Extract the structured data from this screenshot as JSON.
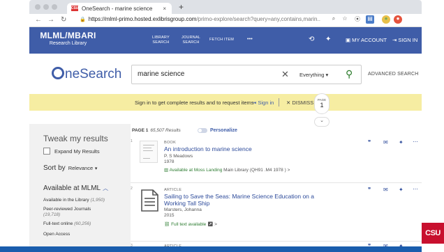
{
  "browser": {
    "tab_title": "OneSearch - marine science",
    "favicon_text": "CSU",
    "tab_close": "×",
    "new_tab": "+",
    "url_lock": "🔒",
    "url_host": "https://mlml-primo.hosted.exlibrisgroup.com",
    "url_path": "/primo-explore/search?query=any,contains,marin..."
  },
  "header": {
    "brand_main": "MLML/MBARI",
    "brand_sub": "Research Library",
    "nav": [
      {
        "line1": "LIBRARY",
        "line2": "SEARCH"
      },
      {
        "line1": "JOURNAL",
        "line2": "SEARCH"
      },
      {
        "line1": "FETCH ITEM",
        "line2": ""
      },
      {
        "line1": "•••",
        "line2": ""
      }
    ],
    "my_account": "MY ACCOUNT",
    "sign_in": "SIGN IN"
  },
  "search": {
    "logo_text": "neSearch",
    "query": "marine science",
    "scope": "Everything",
    "advanced": "ADVANCED SEARCH"
  },
  "notice": {
    "text": "Sign in to get complete results and to request items",
    "sign_in": "Sign in",
    "dismiss": "DISMISS"
  },
  "sidebar": {
    "title": "Tweak my results",
    "expand": "Expand My Results",
    "sort_label": "Sort by",
    "sort_value": "Relevance",
    "avail_title": "Available at MLML",
    "facets": [
      {
        "label": "Available in the Library",
        "count": "(1,950)"
      },
      {
        "label": "Peer-reviewed Journals",
        "count": "(19,718)"
      },
      {
        "label": "Full-text online",
        "count": "(60,256)"
      },
      {
        "label": "Open Access",
        "count": ""
      }
    ]
  },
  "results": {
    "page_label": "PAGE 1",
    "count": "65,507 Results",
    "personalize": "Personalize",
    "items": [
      {
        "num": "1",
        "type": "BOOK",
        "title": "An introduction to marine science",
        "author": "P. S Meadows",
        "year": "1978",
        "avail": "Available at Moss Landing",
        "location": "Main Library (QH91 .M4 1978 )",
        "avail_suffix": ">"
      },
      {
        "num": "2",
        "type": "ARTICLE",
        "title": "Sailing to Save the Seas: Marine Science Education on a Working Tall Ship",
        "author": "Marsters, Johanna",
        "year": "2015",
        "avail": "Full text available",
        "location": "",
        "avail_suffix": "↗ >"
      },
      {
        "num": "3",
        "type": "ARTICLE",
        "title": "",
        "author": "",
        "year": "",
        "avail": "",
        "location": "",
        "avail_suffix": ""
      }
    ],
    "page_badge_label": "PAGE",
    "page_badge_num": "1"
  },
  "slide": {
    "logo": "CSU"
  }
}
